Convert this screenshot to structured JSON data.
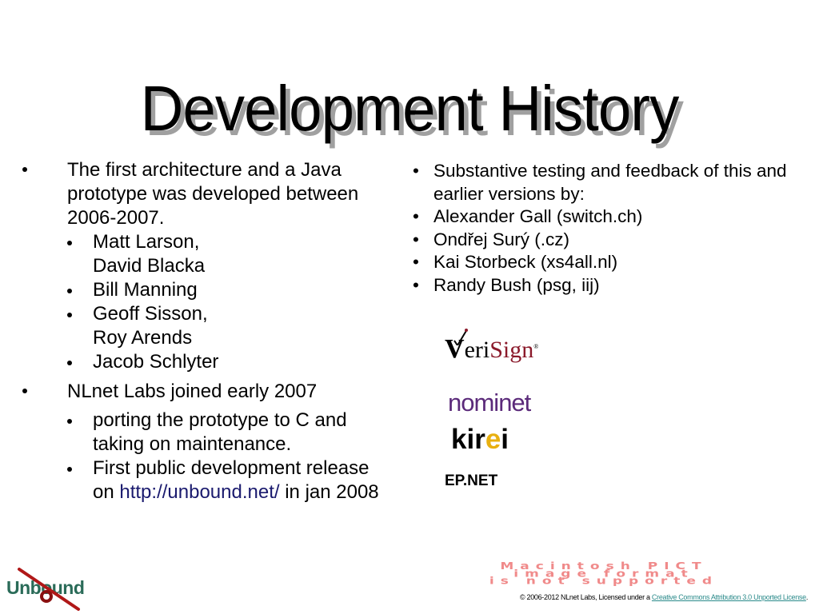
{
  "slide": {
    "title": "Development History",
    "left_column": {
      "items": [
        {
          "text": "The first architecture and a Java prototype was developed between 2006-2007.",
          "subitems": [
            {
              "text": "Matt Larson, David Blacka"
            },
            {
              "text": "Bill Manning"
            },
            {
              "text": "Geoff Sisson, Roy Arends"
            },
            {
              "text": "Jacob Schlyter"
            }
          ]
        },
        {
          "text": "NLnet Labs joined early 2007",
          "subitems": [
            {
              "text": "porting the prototype to C and taking on maintenance."
            },
            {
              "text_before_link": "First public development release on ",
              "link": "http://unbound.net/",
              "text_after_link": " in jan 2008"
            }
          ]
        }
      ]
    },
    "right_column": {
      "items": [
        "Substantive testing and feedback of this and earlier versions by:",
        "Alexander Gall (switch.ch)",
        "Ondřej Surý (.cz)",
        "Kai Storbeck (xs4all.nl)",
        "Randy Bush (psg, iij)"
      ]
    },
    "sponsor_logos": {
      "verisign_v": "V",
      "verisign_eri": "eri",
      "verisign_sign": "Sign",
      "verisign_reg": "®",
      "nominet": "nominet",
      "kirei_kir": "kir",
      "kirei_e": "e",
      "kirei_i": "i",
      "epnet": "EP.NET"
    },
    "unbound_logo_text": "Unbound",
    "pict_placeholder": [
      "Macintosh PICT",
      "image format",
      "is not supported"
    ],
    "footer": {
      "text": "© 2006-2012 NLnet Labs, Licensed under a ",
      "link": "Creative Commons Attribution 3.0 Unported License",
      "end": "."
    },
    "colors": {
      "link": "#1a1a6e",
      "verisign_sign": "#8b1a2b",
      "nominet": "#5b2a7a",
      "kirei_accent": "#e8b010",
      "unbound": "#2a6b58",
      "unbound_knot": "#b01818",
      "pict_placeholder": "#f08a8a",
      "footer_link": "#2a8a8a"
    }
  }
}
